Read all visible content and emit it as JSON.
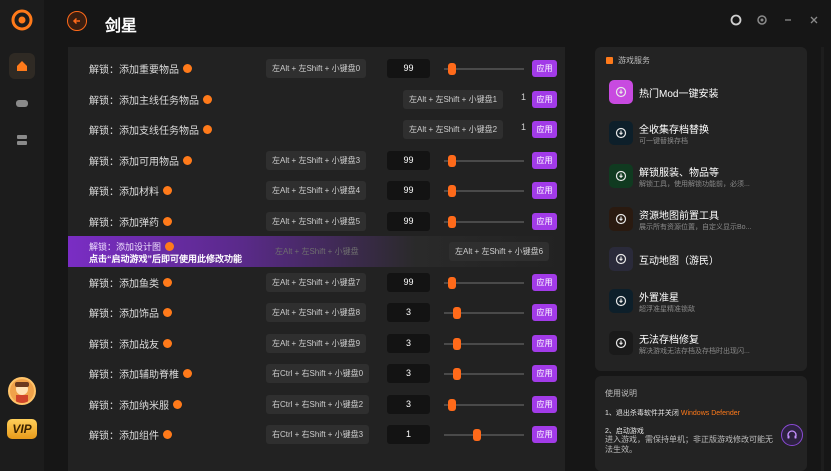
{
  "app": {
    "title": "剑星",
    "vip_label": "VIP"
  },
  "rail": {
    "items": [
      "home-icon",
      "gamepad-icon",
      "storage-icon"
    ]
  },
  "list": {
    "rows": [
      {
        "label": "解锁：添加重要物品",
        "hotkey": "左Alt + 左Shift + 小键盘0",
        "value": "99",
        "slider": 0.05,
        "apply": "应用",
        "type": "slider"
      },
      {
        "label": "解锁：添加主线任务物品",
        "hotkey": "左Alt + 左Shift + 小键盘1",
        "inline_value": "1",
        "apply": "应用",
        "type": "inline"
      },
      {
        "label": "解锁：添加支线任务物品",
        "hotkey": "左Alt + 左Shift + 小键盘2",
        "inline_value": "1",
        "apply": "应用",
        "type": "inline"
      },
      {
        "label": "解锁：添加可用物品",
        "hotkey": "左Alt + 左Shift + 小键盘3",
        "value": "99",
        "slider": 0.05,
        "apply": "应用",
        "type": "slider"
      },
      {
        "label": "解锁：添加材料",
        "hotkey": "左Alt + 左Shift + 小键盘4",
        "value": "99",
        "slider": 0.05,
        "apply": "应用",
        "type": "slider"
      },
      {
        "label": "解锁：添加弹药",
        "hotkey": "左Alt + 左Shift + 小键盘5",
        "value": "99",
        "slider": 0.05,
        "apply": "应用",
        "type": "slider"
      },
      {
        "label": "解锁：添加鱼类",
        "hotkey": "左Alt + 左Shift + 小键盘7",
        "value": "99",
        "slider": 0.05,
        "apply": "应用",
        "type": "slider"
      },
      {
        "label": "解锁：添加饰品",
        "hotkey": "左Alt + 左Shift + 小键盘8",
        "value": "3",
        "slider": 0.12,
        "apply": "应用",
        "type": "slider"
      },
      {
        "label": "解锁：添加战友",
        "hotkey": "左Alt + 左Shift + 小键盘9",
        "value": "3",
        "slider": 0.12,
        "apply": "应用",
        "type": "slider"
      },
      {
        "label": "解锁：添加辅助脊椎",
        "hotkey": "右Ctrl + 右Shift + 小键盘0",
        "value": "3",
        "slider": 0.12,
        "apply": "应用",
        "type": "slider"
      },
      {
        "label": "解锁：添加纳米服",
        "hotkey": "右Ctrl + 右Shift + 小键盘2",
        "value": "3",
        "slider": 0.05,
        "apply": "应用",
        "type": "slider"
      },
      {
        "label": "解锁：添加组件",
        "hotkey": "右Ctrl + 右Shift + 小键盘3",
        "value": "1",
        "slider": 0.4,
        "apply": "应用",
        "type": "slider"
      }
    ],
    "highlight": {
      "label": "解锁：添加设计图",
      "notice": "点击“启动游戏”后即可使用此修改功能",
      "hotkey_faded": "左Alt + 左Shift + 小键盘",
      "hotkey": "左Alt + 左Shift + 小键盘6"
    }
  },
  "services": {
    "header": "游戏服务",
    "items": [
      {
        "title": "热门Mod一键安装",
        "sub": ""
      },
      {
        "title": "全收集存档替换",
        "sub": "可一键替换存档"
      },
      {
        "title": "解锁服装、物品等",
        "sub": "解锁工具，使用解锁功能前，必须..."
      },
      {
        "title": "资源地图前置工具",
        "sub": "展示所有资源位置，自定义显示Bo..."
      },
      {
        "title": "互动地图（游民）",
        "sub": ""
      },
      {
        "title": "外置准星",
        "sub": "超浮准星精准锁敌"
      },
      {
        "title": "无法存档修复",
        "sub": "解决游戏无法存档及存档时出现闪..."
      }
    ]
  },
  "usage": {
    "header": "使用说明",
    "item1_prefix": "1、退出杀毒软件并关闭",
    "item1_highlight": "Windows Defender",
    "item2": "2、启动游戏",
    "item2_desc": "进入游戏，需保持单机；非正版游戏修改可能无法生效。"
  },
  "colors": {
    "accent": "#ff6a1a",
    "purple": "#a23be8",
    "bg": "#161616",
    "panel": "#222222"
  }
}
